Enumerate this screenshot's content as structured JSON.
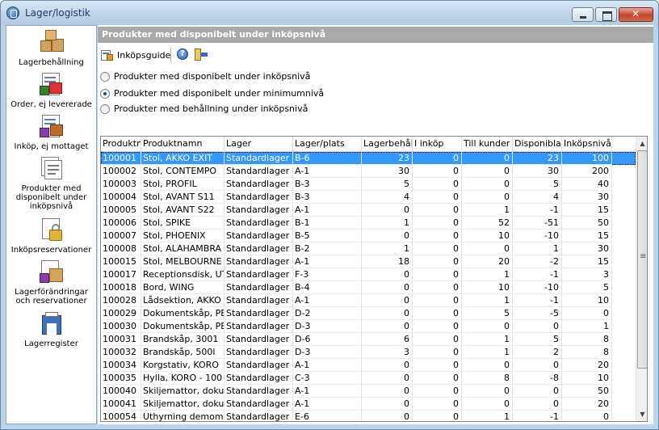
{
  "window": {
    "title": "Lager/logistik"
  },
  "sidebar": {
    "items": [
      {
        "label": "Lagerbehållning",
        "icon": "boxes-icon"
      },
      {
        "label": "Order, ej levererade",
        "icon": "order-form-icon"
      },
      {
        "label": "Inköp, ej mottaget",
        "icon": "purchase-form-icon"
      },
      {
        "label": "Produkter med disponibelt under inköpsnivå",
        "icon": "document-stack-icon"
      },
      {
        "label": "Inköpsreservationer",
        "icon": "locked-document-icon"
      },
      {
        "label": "Lagerförändringar och reservationer",
        "icon": "inventory-change-icon"
      },
      {
        "label": "Lagerregister",
        "icon": "warehouse-register-icon"
      }
    ]
  },
  "main": {
    "header": "Produkter med disponibelt under inköpsnivå",
    "toolbar": {
      "guide_label": "Inköpsguide"
    },
    "options": [
      {
        "label": "Produkter med disponibelt under inköpsnivå",
        "selected": false
      },
      {
        "label": "Produkter med disponibelt under minimumnivå",
        "selected": true
      },
      {
        "label": "Produkter med behållning under inköpsnivå",
        "selected": false
      }
    ],
    "table": {
      "columns": [
        "Produktnr.",
        "Produktnamn",
        "Lager",
        "Lager/plats",
        "Lagerbehålln",
        "I inköp",
        "Till kunder",
        "Disponibla",
        "Inköpsnivå"
      ],
      "rows": [
        [
          "100001",
          "Stol, AKKO EXIT",
          "Standardlager",
          "B-6",
          "23",
          "0",
          "0",
          "23",
          "100"
        ],
        [
          "100002",
          "Stol, CONTEMPO",
          "Standardlager",
          "A-1",
          "30",
          "0",
          "0",
          "30",
          "200"
        ],
        [
          "100003",
          "Stol, PROFIL",
          "Standardlager",
          "B-3",
          "5",
          "0",
          "0",
          "5",
          "40"
        ],
        [
          "100004",
          "Stol, AVANT S11",
          "Standardlager",
          "B-3",
          "4",
          "0",
          "0",
          "4",
          "30"
        ],
        [
          "100005",
          "Stol, AVANT S22",
          "Standardlager",
          "A-1",
          "0",
          "0",
          "1",
          "-1",
          "15"
        ],
        [
          "100006",
          "Stol, SPIKE",
          "Standardlager",
          "B-1",
          "1",
          "0",
          "52",
          "-51",
          "50"
        ],
        [
          "100007",
          "Stol, PHOENIX",
          "Standardlager",
          "B-5",
          "0",
          "0",
          "10",
          "-10",
          "15"
        ],
        [
          "100008",
          "Stol, ALAHAMBRA",
          "Standardlager",
          "B-2",
          "1",
          "0",
          "0",
          "1",
          "30"
        ],
        [
          "100015",
          "Stol, MELBOURNE",
          "Standardlager",
          "A-1",
          "18",
          "0",
          "20",
          "-2",
          "15"
        ],
        [
          "100017",
          "Receptionsdisk, UTV",
          "Standardlager",
          "F-3",
          "0",
          "0",
          "1",
          "-1",
          "3"
        ],
        [
          "100018",
          "Bord, WING",
          "Standardlager",
          "B-4",
          "0",
          "0",
          "10",
          "-10",
          "5"
        ],
        [
          "100028",
          "Lådsektion, AKKO P",
          "Standardlager",
          "A-1",
          "0",
          "0",
          "1",
          "-1",
          "10"
        ],
        [
          "100029",
          "Dokumentskåp, PEG",
          "Standardlager",
          "D-2",
          "0",
          "0",
          "5",
          "-5",
          "0"
        ],
        [
          "100030",
          "Dokumentskåp, PEG",
          "Standardlager",
          "D-3",
          "0",
          "0",
          "0",
          "0",
          "1"
        ],
        [
          "100031",
          "Brandskåp, 3001",
          "Standardlager",
          "D-6",
          "6",
          "0",
          "1",
          "5",
          "8"
        ],
        [
          "100032",
          "Brandskåp, 500l",
          "Standardlager",
          "D-3",
          "3",
          "0",
          "1",
          "2",
          "8"
        ],
        [
          "100034",
          "Korgstativ, KORO",
          "Standardlager",
          "A-1",
          "0",
          "0",
          "0",
          "0",
          "20"
        ],
        [
          "100035",
          "Hylla, KORO - 100",
          "Standardlager",
          "C-3",
          "0",
          "0",
          "8",
          "-8",
          "10"
        ],
        [
          "100040",
          "Skiljemattor, dokume",
          "Standardlager",
          "A-1",
          "0",
          "0",
          "0",
          "0",
          "50"
        ],
        [
          "100041",
          "Skiljemattor, dokume",
          "Standardlager",
          "A-1",
          "0",
          "0",
          "0",
          "0",
          "20"
        ],
        [
          "100054",
          "Uthyrning demomöbl",
          "Standardlager",
          "E-6",
          "0",
          "0",
          "1",
          "-1",
          "0"
        ]
      ]
    }
  }
}
